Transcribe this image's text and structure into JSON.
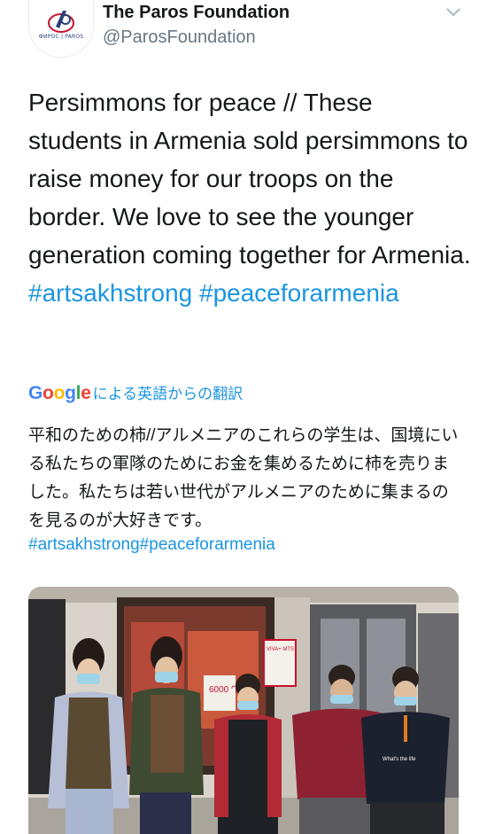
{
  "account": {
    "display_name": "The Paros Foundation",
    "handle": "@ParosFoundation",
    "avatar_logo_text": "ФИРОС | PAROS"
  },
  "tweet": {
    "text_plain": "Persimmons for peace // These students in Armenia sold persimmons to raise money for our troops on the border. We love to see the younger generation coming together for Armenia. ",
    "hashtag_1": "#artsakhstrong",
    "hashtag_2": "#peaceforarmenia"
  },
  "translation": {
    "google_logo": "Google",
    "label": "による英語からの翻訳",
    "text": "平和のための柿//アルメニアのこれらの学生は、国境にいる私たちの軍隊のためにお金を集めるために柿を売りました。私たちは若い世代がアルメニアのために集まるのを見るのが大好きです。",
    "hashtags": "#artsakhstrong#peaceforarmenia"
  },
  "photo": {
    "store_sign": "6000 Դ",
    "vivacell_sign": "VIVA+ MTS",
    "shirt_text": "What's the life"
  },
  "colors": {
    "link": "#1b95e0",
    "text": "#14171a",
    "secondary": "#657786"
  }
}
